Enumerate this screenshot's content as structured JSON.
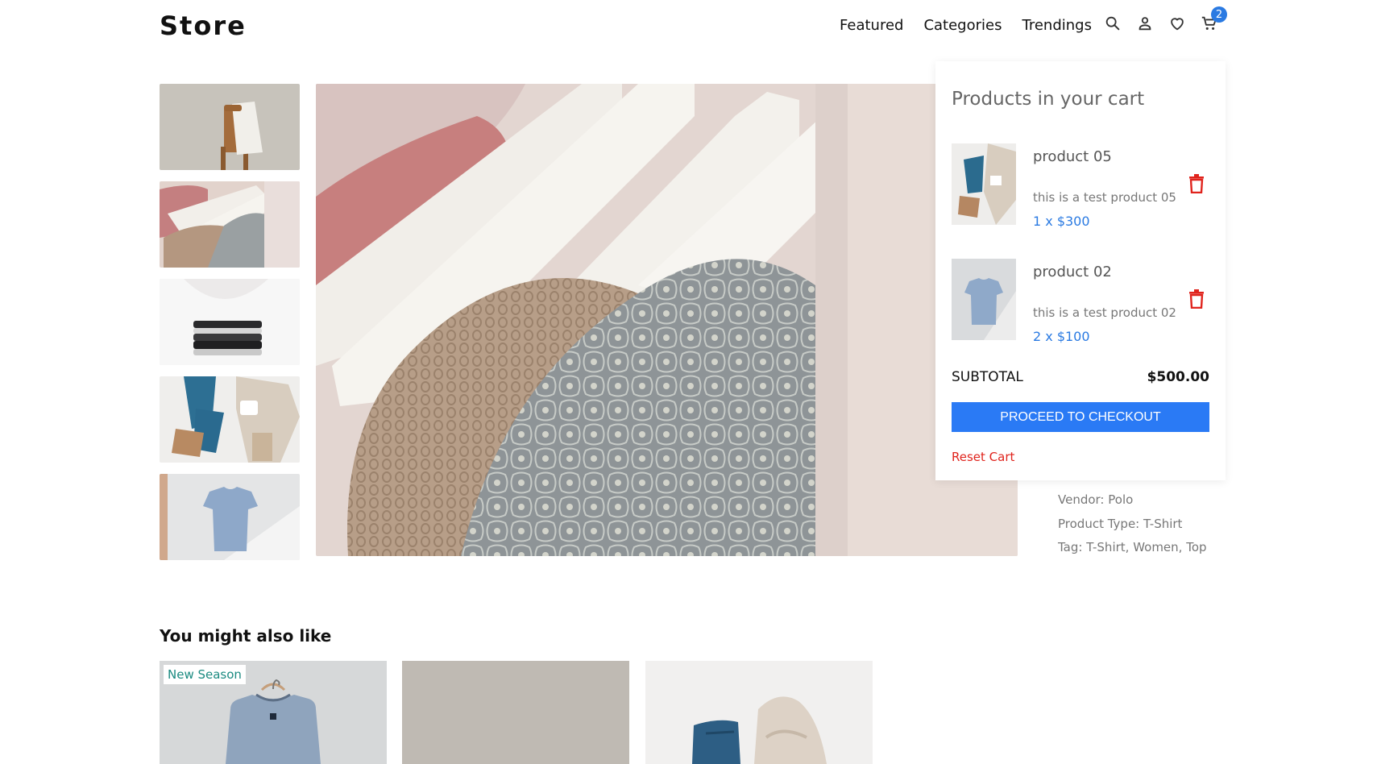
{
  "header": {
    "logo": "Store",
    "nav": [
      "Featured",
      "Categories",
      "Trendings"
    ],
    "cart_count": "2"
  },
  "gallery": {
    "thumbnails": [
      "chair-with-shirt",
      "knit-sweaters-on-hangers",
      "folded-clothes-stack",
      "flatlay-jeans-boots",
      "blue-tshirt-on-hanger"
    ],
    "selected_index": 1
  },
  "details": {
    "vendor": "Vendor: Polo",
    "product_type": "Product Type: T-Shirt",
    "tags": "Tag: T-Shirt, Women, Top"
  },
  "cart": {
    "title": "Products in your cart",
    "items": [
      {
        "name": "product 05",
        "description": "this is a test product 05",
        "qty_price": "1 x $300"
      },
      {
        "name": "product 02",
        "description": "this is a test product 02",
        "qty_price": "2 x $100"
      }
    ],
    "subtotal_label": "SUBTOTAL",
    "subtotal_value": "$500.00",
    "checkout_label": "PROCEED TO CHECKOUT",
    "reset_label": "Reset Cart"
  },
  "also_like": {
    "title": "You might also like",
    "badge": "New Season"
  },
  "colors": {
    "accent": "#2a7af5",
    "danger": "#e0241d",
    "badge_text": "#1a8a80"
  }
}
